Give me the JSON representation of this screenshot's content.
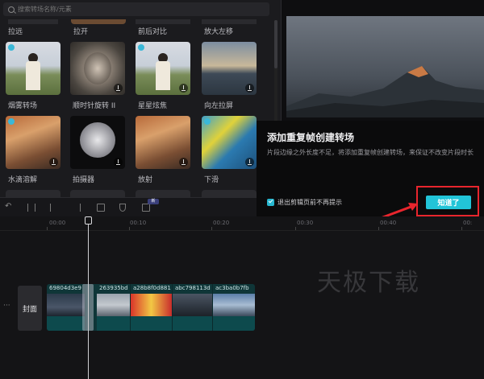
{
  "search": {
    "placeholder": "搜索转场名称/元素"
  },
  "top_labels": [
    "拉远",
    "拉开",
    "前后对比",
    "放大左移"
  ],
  "tiles": [
    {
      "label": "烟雾转场"
    },
    {
      "label": "顺时针旋转 II"
    },
    {
      "label": "星星炫焦"
    },
    {
      "label": "向左拉屏"
    },
    {
      "label": "水滴溶解"
    },
    {
      "label": "拍摄器"
    },
    {
      "label": "放射"
    },
    {
      "label": "下滑"
    }
  ],
  "dialog": {
    "title": "添加重复帧创建转场",
    "message": "片段边缘之外长度不足，将添加重复帧创建转场，来保证不改变片段时长",
    "checkbox_label": "退出剪辑页前不再提示",
    "confirm_label": "知道了"
  },
  "toolbar": {
    "badge": "新"
  },
  "timeline": {
    "ruler": [
      "00:00",
      "00:10",
      "00:20",
      "00:30",
      "00:40",
      "00:"
    ],
    "cover_label": "封面",
    "more_label": "···",
    "clips": [
      {
        "name": "69804d3e9"
      },
      {
        "name": "263935bd"
      },
      {
        "name": "a28b8f0d881"
      },
      {
        "name": "abc798113d"
      },
      {
        "name": "ac3ba0b7fb"
      }
    ]
  },
  "watermark": "天极下载",
  "colors": {
    "accent": "#22c4d8",
    "highlight": "#e8252d"
  }
}
